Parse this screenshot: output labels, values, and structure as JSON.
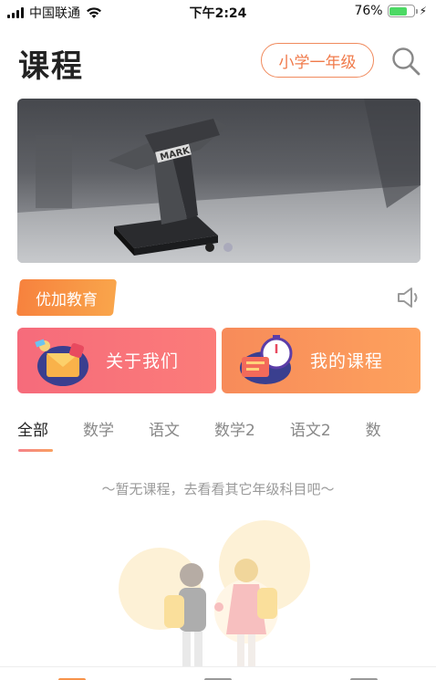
{
  "status_bar": {
    "carrier": "中国联通",
    "time": "下午2:24",
    "battery_percent": "76%",
    "battery_level": 0.76,
    "battery_color": "#4cd964"
  },
  "header": {
    "title": "课程",
    "grade_selector": "小学一年级",
    "search_icon": "search-icon",
    "accent_color": "#f07a4a"
  },
  "banner": {
    "trophy_text": "MARK",
    "slide_count": 2,
    "active_slide": 1
  },
  "brand": {
    "tag": "优加教育",
    "speaker_icon": "speaker-icon"
  },
  "cards": [
    {
      "label": "关于我们",
      "icon": "envelope-illustration-icon"
    },
    {
      "label": "我的课程",
      "icon": "stopwatch-illustration-icon"
    }
  ],
  "tabs": [
    {
      "label": "全部",
      "active": true
    },
    {
      "label": "数学",
      "active": false
    },
    {
      "label": "语文",
      "active": false
    },
    {
      "label": "数学2",
      "active": false
    },
    {
      "label": "语文2",
      "active": false
    },
    {
      "label": "数",
      "active": false
    }
  ],
  "empty_state": {
    "message": "～暂无课程，去看看其它年级科目吧～"
  }
}
